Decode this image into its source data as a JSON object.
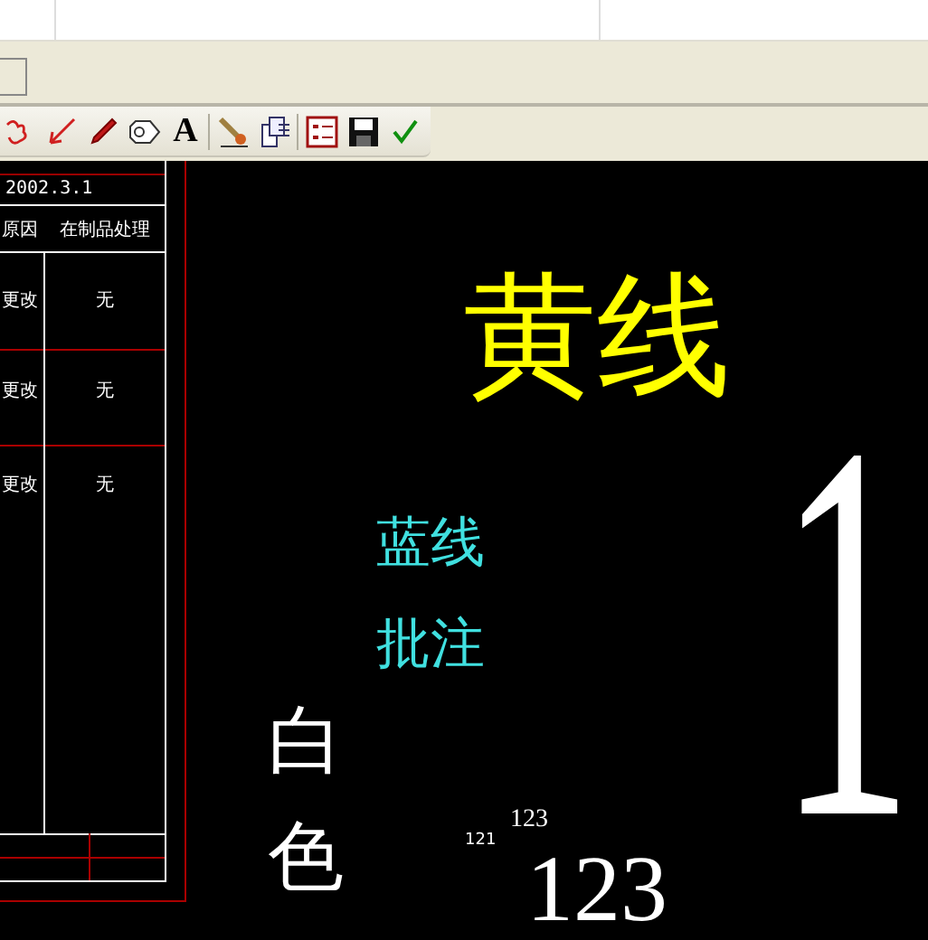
{
  "toolbar": {
    "tools": [
      {
        "kind": "cloud"
      },
      {
        "kind": "arrow"
      },
      {
        "kind": "pencil"
      },
      {
        "kind": "tag"
      },
      {
        "kind": "text",
        "label": "A"
      },
      {
        "kind": "brush"
      },
      {
        "kind": "document"
      },
      {
        "kind": "list"
      },
      {
        "kind": "save"
      },
      {
        "kind": "check"
      }
    ]
  },
  "drawing": {
    "table": {
      "date": "2002.3.1",
      "headers": [
        "原因",
        "在制品处理"
      ],
      "rows": [
        {
          "change": "更改",
          "handling": "无"
        },
        {
          "change": "更改",
          "handling": "无"
        },
        {
          "change": "更改",
          "handling": "无"
        }
      ]
    },
    "annotations": [
      {
        "kind": "yellow",
        "text": "黄线"
      },
      {
        "kind": "cyan",
        "text": "蓝线"
      },
      {
        "kind": "cyan2",
        "text": "批注"
      },
      {
        "kind": "white-v1",
        "text": "白"
      },
      {
        "kind": "white-v2",
        "text": "色"
      },
      {
        "kind": "tiny",
        "text": "121"
      },
      {
        "kind": "small",
        "text": "123"
      },
      {
        "kind": "large",
        "text": "123"
      },
      {
        "kind": "white-big",
        "text": "1"
      }
    ]
  }
}
